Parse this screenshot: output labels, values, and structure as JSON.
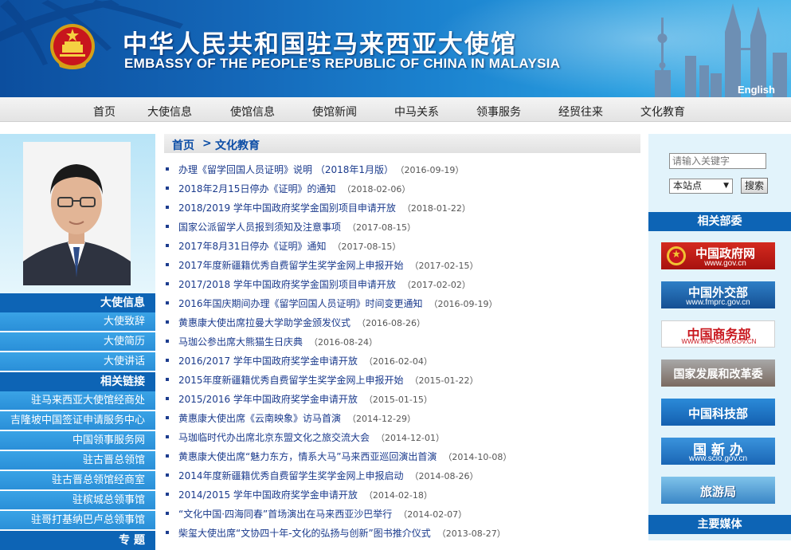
{
  "header": {
    "title_cn": "中华人民共和国驻马来西亚大使馆",
    "title_en": "EMBASSY OF THE PEOPLE'S REPUBLIC OF CHINA IN MALAYSIA",
    "english_link": "English"
  },
  "nav": {
    "items": [
      {
        "label": "首页"
      },
      {
        "label": "大使信息"
      },
      {
        "label": "使馆信息"
      },
      {
        "label": "使馆新闻"
      },
      {
        "label": "中马关系"
      },
      {
        "label": "领事服务"
      },
      {
        "label": "经贸往来"
      },
      {
        "label": "文化教育"
      }
    ]
  },
  "left": {
    "ambassador_head": "大使信息",
    "ambassador_links": [
      {
        "label": "大使致辞"
      },
      {
        "label": "大使简历"
      },
      {
        "label": "大使讲话"
      }
    ],
    "related_head": "相关链接",
    "related_links": [
      {
        "label": "驻马来西亚大使馆经商处"
      },
      {
        "label": "吉隆坡中国签证申请服务中心"
      },
      {
        "label": "中国领事服务网"
      },
      {
        "label": "驻古晋总领馆"
      },
      {
        "label": "驻古晋总领馆经商室"
      },
      {
        "label": "驻槟城总领事馆"
      },
      {
        "label": "驻哥打基纳巴卢总领事馆"
      }
    ],
    "topic_head": "专 题"
  },
  "breadcrumb": {
    "home": "首页",
    "separator": ">",
    "current": "文化教育"
  },
  "news": [
    {
      "title": "办理《留学回国人员证明》说明 （2018年1月版）",
      "date": "（2016-09-19）"
    },
    {
      "title": "2018年2月15日停办《证明》的通知",
      "date": "（2018-02-06）"
    },
    {
      "title": "2018/2019 学年中国政府奖学金国别项目申请开放",
      "date": "（2018-01-22）"
    },
    {
      "title": "国家公派留学人员报到须知及注意事项",
      "date": "（2017-08-15）"
    },
    {
      "title": "2017年8月31日停办《证明》通知",
      "date": "（2017-08-15）"
    },
    {
      "title": "2017年度新疆籍优秀自费留学生奖学金网上申报开始",
      "date": "（2017-02-15）"
    },
    {
      "title": "2017/2018 学年中国政府奖学金国别项目申请开放",
      "date": "（2017-02-02）"
    },
    {
      "title": "2016年国庆期间办理《留学回国人员证明》时间变更通知",
      "date": "（2016-09-19）"
    },
    {
      "title": "黄惠康大使出席拉曼大学助学金颁发仪式",
      "date": "（2016-08-26）"
    },
    {
      "title": "马珈公参出席大熊猫生日庆典",
      "date": "（2016-08-24）"
    },
    {
      "title": "2016/2017 学年中国政府奖学金申请开放",
      "date": "（2016-02-04）"
    },
    {
      "title": "2015年度新疆籍优秀自费留学生奖学金网上申报开始",
      "date": "（2015-01-22）"
    },
    {
      "title": "2015/2016 学年中国政府奖学金申请开放",
      "date": "（2015-01-15）"
    },
    {
      "title": "黄惠康大使出席《云南映象》访马首演",
      "date": "（2014-12-29）"
    },
    {
      "title": "马珈临时代办出席北京东盟文化之旅交流大会",
      "date": "（2014-12-01）"
    },
    {
      "title": "黄惠康大使出席“魅力东方，情系大马”马来西亚巡回演出首演",
      "date": "（2014-10-08）"
    },
    {
      "title": "2014年度新疆籍优秀自费留学生奖学金网上申报启动",
      "date": "（2014-08-26）"
    },
    {
      "title": "2014/2015 学年中国政府奖学金申请开放",
      "date": "（2014-02-18）"
    },
    {
      "title": "“文化中国·四海同春”首场演出在马来西亚沙巴举行",
      "date": "（2014-02-07）"
    },
    {
      "title": "柴玺大使出席“文协四十年-文化的弘扬与创新”图书推介仪式",
      "date": "（2013-08-27）"
    }
  ],
  "search": {
    "placeholder": "请输入关键字",
    "scope": "本站点",
    "button": "搜索"
  },
  "right": {
    "dept_head": "相关部委",
    "departments": [
      {
        "name": "中国政府网",
        "sub": "www.gov.cn"
      },
      {
        "name": "中国外交部",
        "sub": "www.fmprc.gov.cn"
      },
      {
        "name": "中国商务部",
        "sub": "WWW.MOFCOM.GOV.CN"
      },
      {
        "name": "国家发展和改革委",
        "sub": ""
      },
      {
        "name": "中国科技部",
        "sub": ""
      },
      {
        "name": "国 新 办",
        "sub": "www.scio.gov.cn"
      },
      {
        "name": "旅游局",
        "sub": ""
      }
    ],
    "media_head": "主要媒体"
  },
  "colors": {
    "nav_blue": "#0d64b5",
    "link_blue": "#1a3a8c",
    "gov_red": "#c8161d"
  }
}
